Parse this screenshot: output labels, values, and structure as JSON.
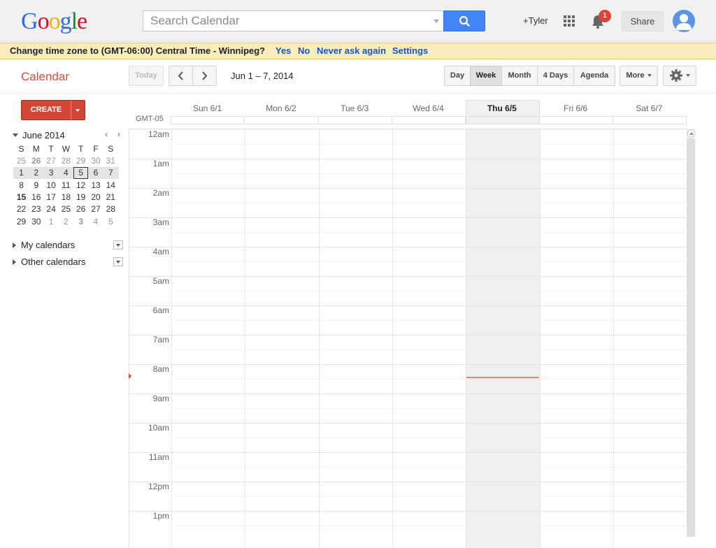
{
  "header": {
    "logo_letters": [
      {
        "char": "G",
        "color": "#3369e8"
      },
      {
        "char": "o",
        "color": "#d50f25"
      },
      {
        "char": "o",
        "color": "#eeb211"
      },
      {
        "char": "g",
        "color": "#3369e8"
      },
      {
        "char": "l",
        "color": "#009925"
      },
      {
        "char": "e",
        "color": "#d50f25"
      }
    ],
    "search_placeholder": "Search Calendar",
    "user_link": "+Tyler",
    "notification_count": "1",
    "share_label": "Share"
  },
  "timezone_banner": {
    "message": "Change time zone to (GMT-06:00) Central Time - Winnipeg?",
    "yes": "Yes",
    "no": "No",
    "never": "Never ask again",
    "settings": "Settings"
  },
  "toolbar": {
    "app_title": "Calendar",
    "today_label": "Today",
    "prev_icon": "chevron-left-icon",
    "next_icon": "chevron-right-icon",
    "date_range": "Jun 1 – 7, 2014",
    "views": [
      "Day",
      "Week",
      "Month",
      "4 Days",
      "Agenda"
    ],
    "selected_view": "Week",
    "more_label": "More"
  },
  "sidebar": {
    "create_label": "CREATE",
    "mini_calendar": {
      "title": "June 2014",
      "weekday_headers": [
        "S",
        "M",
        "T",
        "W",
        "T",
        "F",
        "S"
      ],
      "weeks": [
        [
          "25",
          "26",
          "27",
          "28",
          "29",
          "30",
          "31"
        ],
        [
          "1",
          "2",
          "3",
          "4",
          "5",
          "6",
          "7"
        ],
        [
          "8",
          "9",
          "10",
          "11",
          "12",
          "13",
          "14"
        ],
        [
          "15",
          "16",
          "17",
          "18",
          "19",
          "20",
          "21"
        ],
        [
          "22",
          "23",
          "24",
          "25",
          "26",
          "27",
          "28"
        ],
        [
          "29",
          "30",
          "1",
          "2",
          "3",
          "4",
          "5"
        ]
      ],
      "selected_week_index": 1,
      "today": "5"
    },
    "sections": [
      "My calendars",
      "Other calendars"
    ]
  },
  "week_view": {
    "timezone": "GMT-05",
    "days": [
      "Sun 6/1",
      "Mon 6/2",
      "Tue 6/3",
      "Wed 6/4",
      "Thu 6/5",
      "Fri 6/6",
      "Sat 6/7"
    ],
    "today_index": 4,
    "hours": [
      "12am",
      "1am",
      "2am",
      "3am",
      "4am",
      "5am",
      "6am",
      "7am",
      "8am",
      "9am",
      "10am",
      "11am",
      "12pm",
      "1pm"
    ]
  },
  "colors": {
    "accent_red": "#dd4b39",
    "search_blue": "#4285f4",
    "link_blue": "#1155cc",
    "banner_bg": "#f9edbe"
  }
}
